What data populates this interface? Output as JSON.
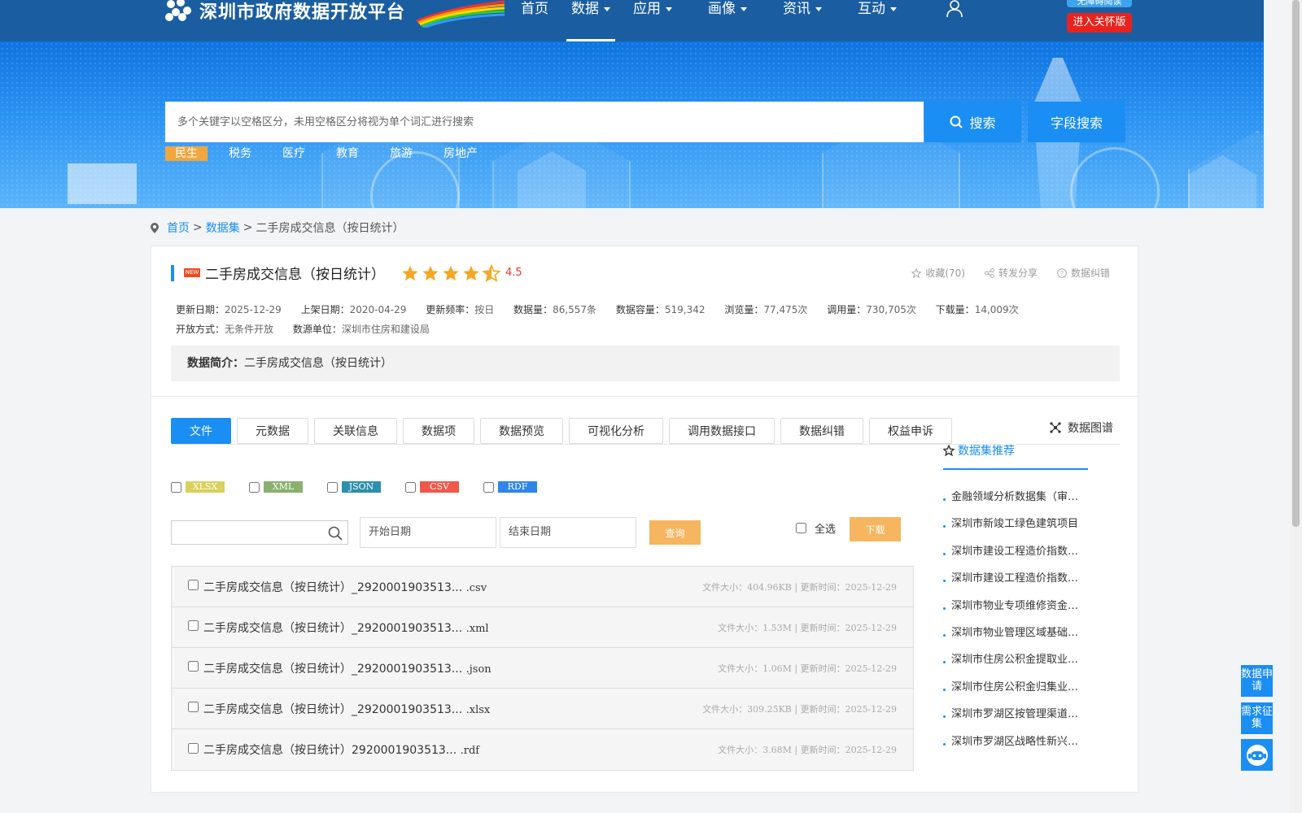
{
  "header": {
    "site_name": "深圳市政府数据开放平台",
    "nav": [
      {
        "label": "首页",
        "dropdown": false,
        "active": false
      },
      {
        "label": "数据",
        "dropdown": true,
        "active": true
      },
      {
        "label": "应用",
        "dropdown": true,
        "active": false
      },
      {
        "label": "画像",
        "dropdown": true,
        "active": false
      },
      {
        "label": "资讯",
        "dropdown": true,
        "active": false
      },
      {
        "label": "互动",
        "dropdown": true,
        "active": false
      }
    ],
    "access_button": "无障碍阅读",
    "care_button": "进入关怀版"
  },
  "search": {
    "placeholder": "多个关键字以空格区分，未用空格区分将视为单个词汇进行搜索",
    "search_button": "搜索",
    "field_search_button": "字段搜索",
    "tags": [
      {
        "label": "民生",
        "active": true
      },
      {
        "label": "税务",
        "active": false
      },
      {
        "label": "医疗",
        "active": false
      },
      {
        "label": "教育",
        "active": false
      },
      {
        "label": "旅游",
        "active": false
      },
      {
        "label": "房地产",
        "active": false
      }
    ]
  },
  "breadcrumb": {
    "home": "首页",
    "dataset": "数据集",
    "current": "二手房成交信息（按日统计）",
    "sep": ">"
  },
  "dataset": {
    "new_badge": "NEW",
    "title": "二手房成交信息（按日统计）",
    "rating": "4.5",
    "stars_full": 4,
    "stars_half": 1,
    "actions": {
      "favorite": "收藏(70)",
      "share": "转发分享",
      "correct": "数据纠错"
    },
    "meta": [
      {
        "label": "更新日期：",
        "value": "2025-12-29"
      },
      {
        "label": "上架日期：",
        "value": "2020-04-29"
      },
      {
        "label": "更新频率：",
        "value": "按日"
      },
      {
        "label": "数据量：",
        "value": "86,557条"
      },
      {
        "label": "数据容量：",
        "value": "519,342"
      },
      {
        "label": "浏览量：",
        "value": "77,475次"
      },
      {
        "label": "调用量：",
        "value": "730,705次"
      },
      {
        "label": "下载量：",
        "value": "14,009次"
      },
      {
        "label": "开放方式：",
        "value": "无条件开放"
      },
      {
        "label": "数源单位：",
        "value": "深圳市住房和建设局"
      }
    ],
    "intro_label": "数据简介：",
    "intro_value": "二手房成交信息（按日统计）"
  },
  "tabs": [
    {
      "label": "文件",
      "active": true
    },
    {
      "label": "元数据",
      "active": false
    },
    {
      "label": "关联信息",
      "active": false
    },
    {
      "label": "数据项",
      "active": false
    },
    {
      "label": "数据预览",
      "active": false
    },
    {
      "label": "可视化分析",
      "active": false
    },
    {
      "label": "调用数据接口",
      "active": false
    },
    {
      "label": "数据纠错",
      "active": false
    },
    {
      "label": "权益申诉",
      "active": false
    }
  ],
  "graph_link": "数据图谱",
  "formats": [
    {
      "label": "XLSX",
      "color": "#d9d15c"
    },
    {
      "label": "XML",
      "color": "#8ab06f"
    },
    {
      "label": "JSON",
      "color": "#2d8fae"
    },
    {
      "label": "CSV",
      "color": "#f0584c"
    },
    {
      "label": "RDF",
      "color": "#2f86e8"
    }
  ],
  "filter": {
    "start_placeholder": "开始日期",
    "end_placeholder": "结束日期",
    "query_button": "查询",
    "select_all": "全选",
    "download_button": "下载"
  },
  "files": [
    {
      "name": "二手房成交信息（按日统计）_2920001903513...",
      "ext": ".csv",
      "size_label": "文件大小：",
      "size": "404.96KB",
      "time_label": "更新时间：",
      "time": "2025-12-29"
    },
    {
      "name": "二手房成交信息（按日统计）_2920001903513...",
      "ext": ".xml",
      "size_label": "文件大小：",
      "size": "1.53M",
      "time_label": "更新时间：",
      "time": "2025-12-29"
    },
    {
      "name": "二手房成交信息（按日统计）_2920001903513...",
      "ext": ".json",
      "size_label": "文件大小：",
      "size": "1.06M",
      "time_label": "更新时间：",
      "time": "2025-12-29"
    },
    {
      "name": "二手房成交信息（按日统计）_2920001903513...",
      "ext": ".xlsx",
      "size_label": "文件大小：",
      "size": "309.25KB",
      "time_label": "更新时间：",
      "time": "2025-12-29"
    },
    {
      "name": "二手房成交信息（按日统计）2920001903513...",
      "ext": ".rdf",
      "size_label": "文件大小：",
      "size": "3.68M",
      "time_label": "更新时间：",
      "time": "2025-12-29"
    }
  ],
  "recommend": {
    "title": "数据集推荐",
    "items": [
      "金融领域分析数据集（审计）",
      "深圳市新竣工绿色建筑项目",
      "深圳市建设工程造价指数信息",
      "深圳市建设工程造价指数信息",
      "深圳市物业专项维修资金信息",
      "深圳市物业管理区域基础信息",
      "深圳市住房公积金提取业务信息",
      "深圳市住房公积金归集业务信息",
      "深圳市罗湖区按管理渠道统计",
      "深圳市罗湖区战略性新兴产业"
    ]
  },
  "float": {
    "data_apply": "数据申请",
    "demand": "需求征集"
  }
}
